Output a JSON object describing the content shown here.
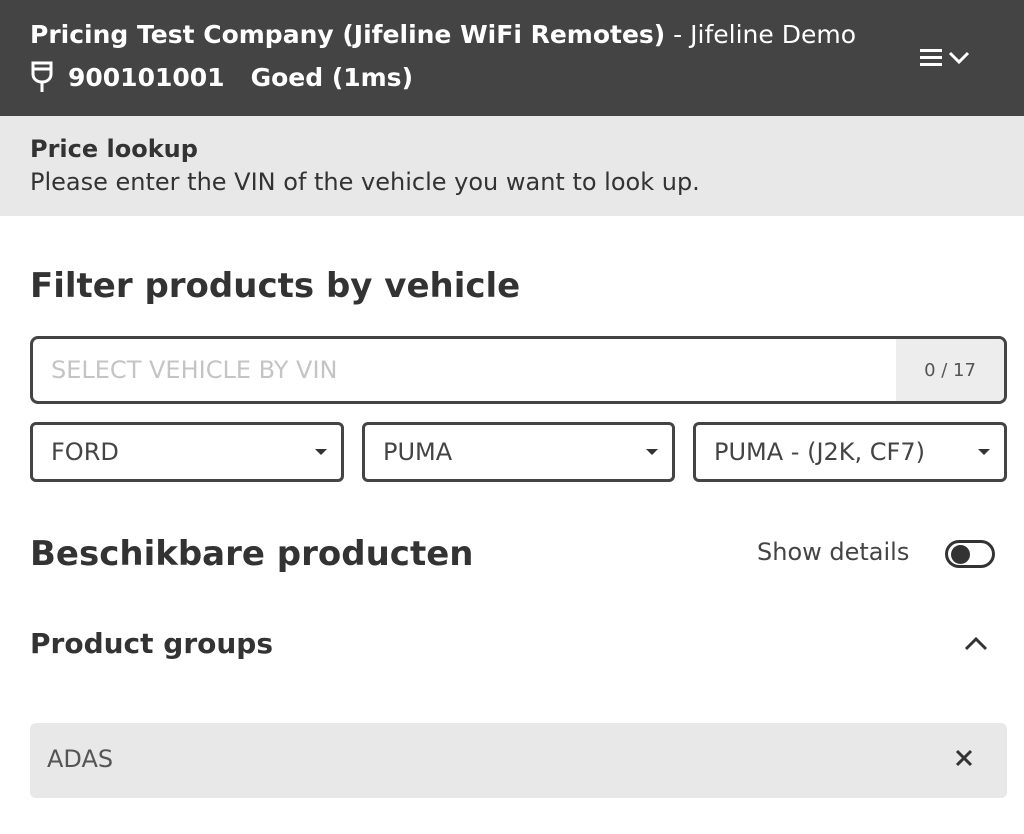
{
  "header": {
    "company": "Pricing Test Company (Jifeline WiFi Remotes)",
    "separator": " - ",
    "demo": "Jifeline Demo",
    "device_id": "900101001",
    "status": "Goed (1ms)",
    "icons": {
      "connector": "plug-icon",
      "menu": "hamburger-icon",
      "dropdown": "chevron-down-icon"
    }
  },
  "subheader": {
    "title": "Price lookup",
    "description": "Please enter the VIN of the vehicle you want to look up."
  },
  "filter": {
    "title": "Filter products by vehicle",
    "vin_placeholder": "SELECT VEHICLE BY VIN",
    "vin_value": "",
    "vin_counter": "0 / 17",
    "make": "FORD",
    "model": "PUMA",
    "variant": "PUMA - (J2K, CF7)"
  },
  "products": {
    "title": "Beschikbare producten",
    "show_details_label": "Show details",
    "show_details_on": false
  },
  "groups": {
    "title": "Product groups",
    "items": [
      {
        "label": "ADAS"
      }
    ]
  },
  "colors": {
    "header_bg": "#444444",
    "subheader_bg": "#e8e8e8",
    "chip_bg": "#e8e8e8",
    "border": "#444444"
  }
}
